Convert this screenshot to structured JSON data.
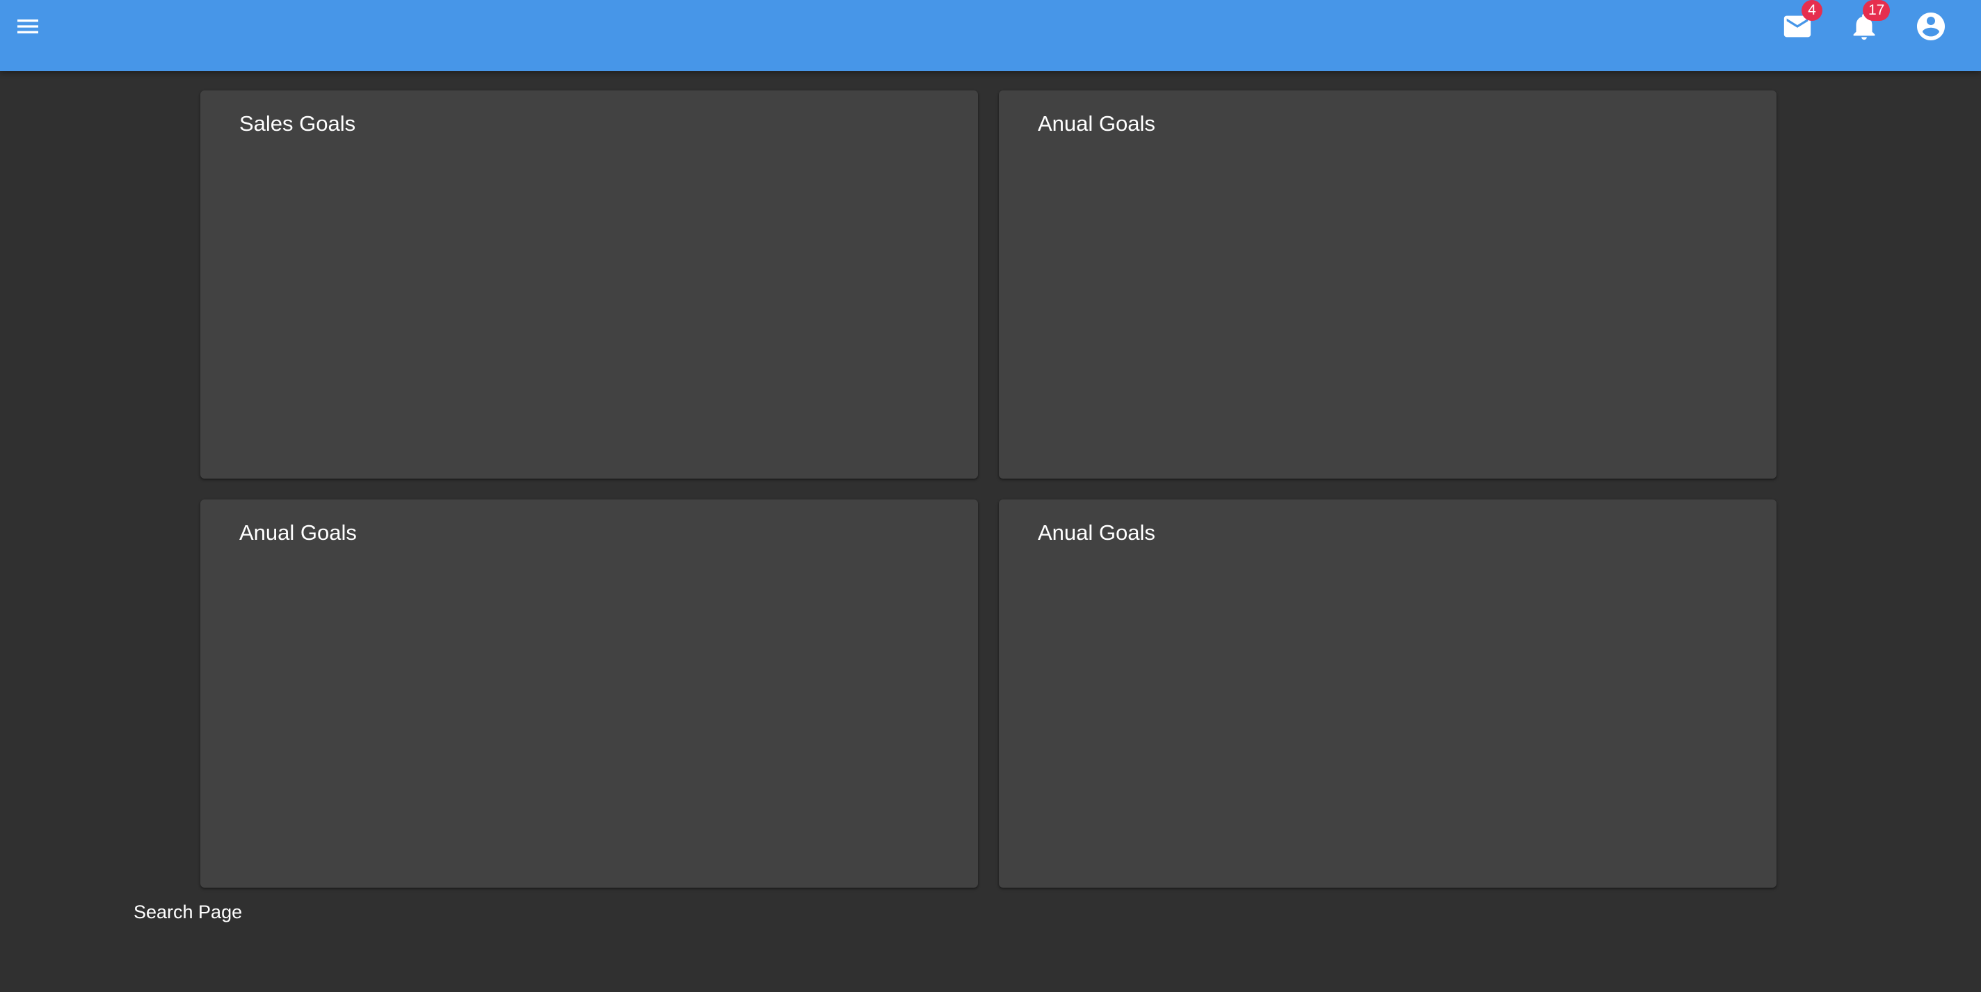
{
  "header": {
    "mail_badge": "4",
    "notifications_badge": "17",
    "icons": {
      "menu": "menu-icon",
      "mail": "mail-icon",
      "notifications": "bell-icon",
      "account": "account-circle-icon"
    }
  },
  "cards": [
    {
      "title": "Sales Goals"
    },
    {
      "title": "Anual Goals"
    },
    {
      "title": "Anual Goals"
    },
    {
      "title": "Anual Goals"
    }
  ],
  "footer": {
    "label": "Search Page"
  },
  "colors": {
    "appbar": "#4796e8",
    "background": "#303030",
    "card": "#424242",
    "badge": "#e62e4e"
  }
}
